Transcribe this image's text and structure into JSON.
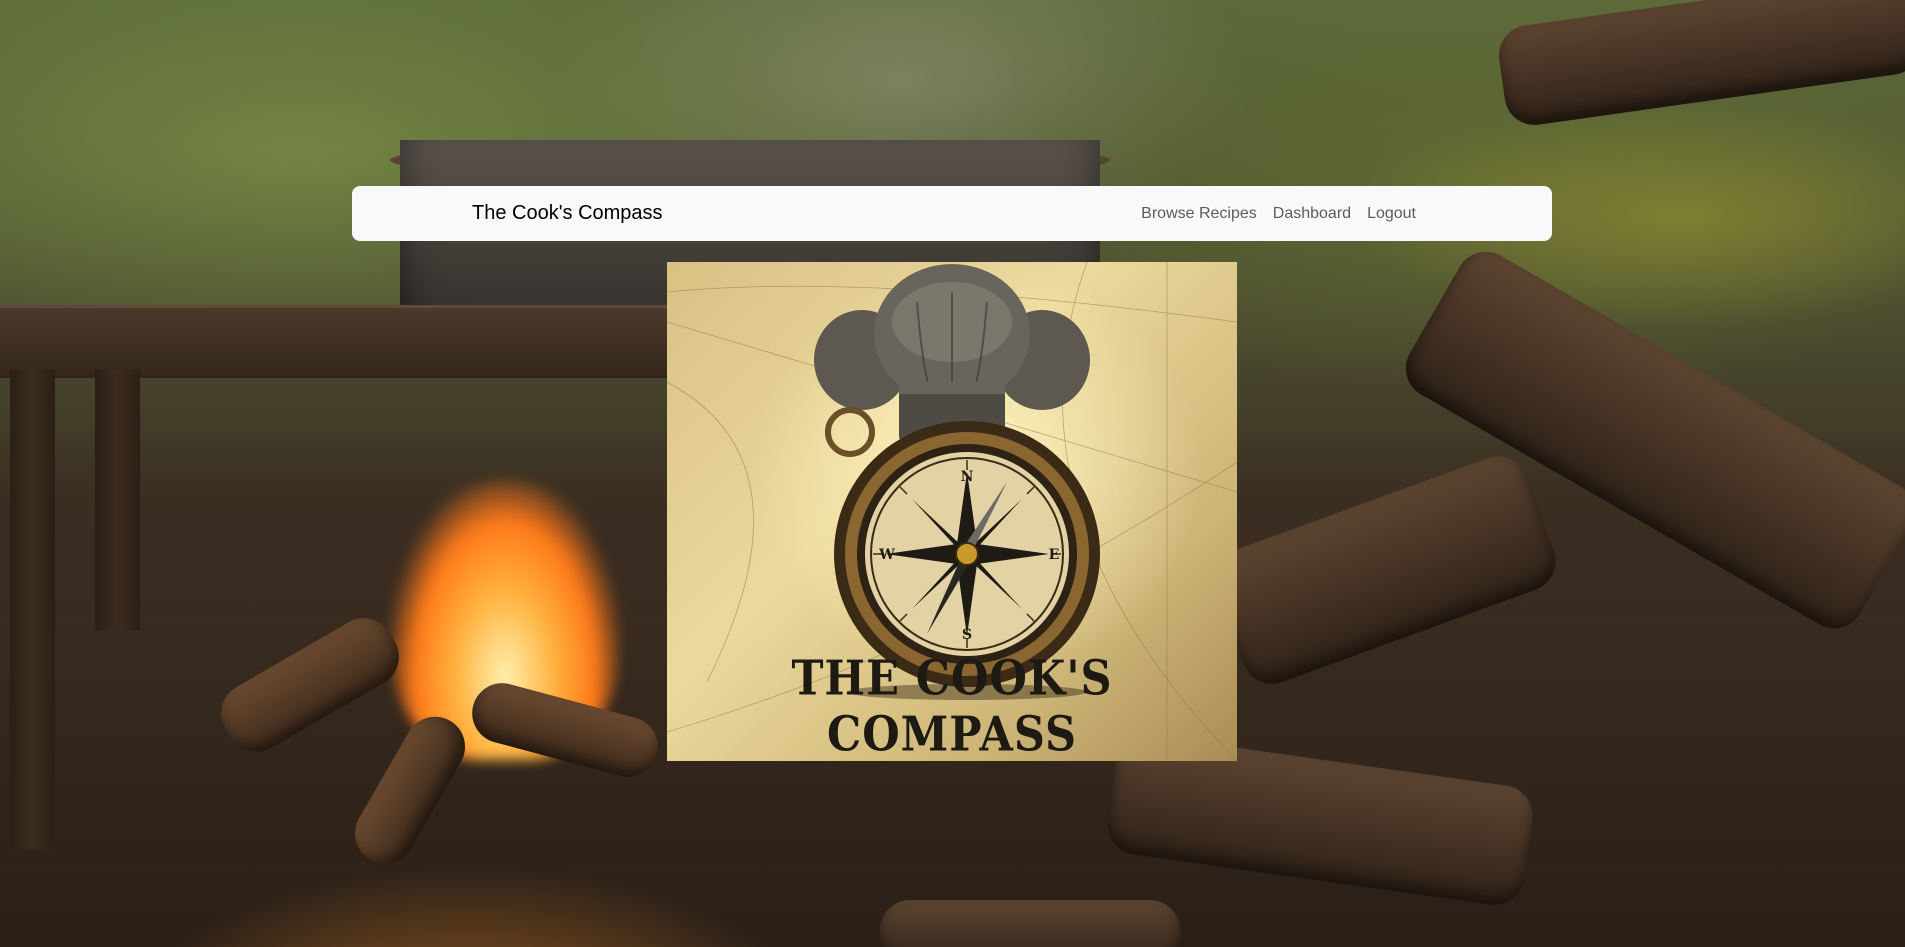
{
  "navbar": {
    "brand": "The Cook's Compass",
    "links": [
      {
        "label": "Browse Recipes"
      },
      {
        "label": "Dashboard"
      },
      {
        "label": "Logout"
      }
    ]
  },
  "logo": {
    "title": "THE COOK'S COMPASS",
    "compass_letters": {
      "north": "N",
      "south": "S",
      "east": "E",
      "west": "W"
    },
    "icon": "chef-hat-compass"
  },
  "background": {
    "scene": "campfire-cooking-outdoors"
  }
}
